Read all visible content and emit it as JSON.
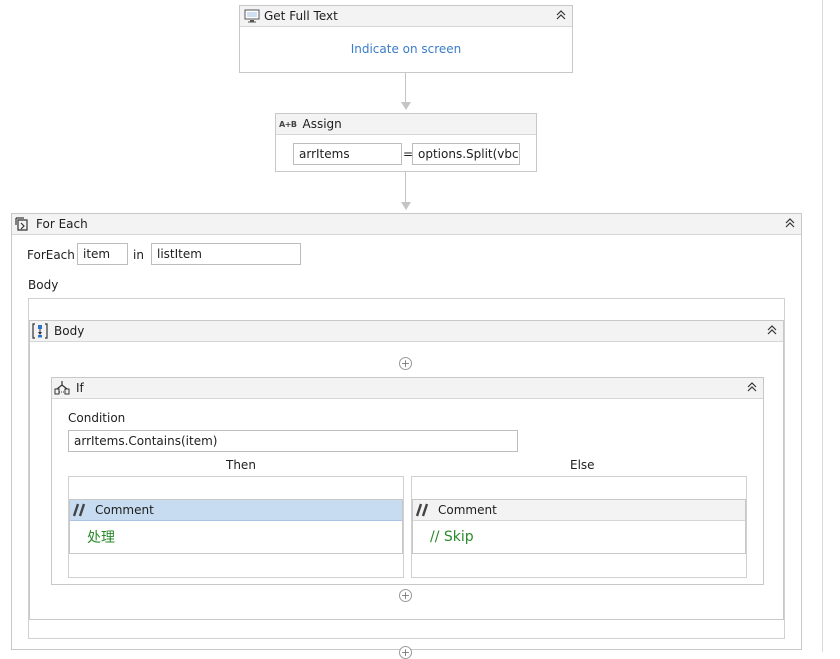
{
  "get_full_text": {
    "title": "Get Full Text",
    "icon": "monitor-icon",
    "indicate_link": "Indicate on screen"
  },
  "assign": {
    "title": "Assign",
    "icon": "assign-ab-icon",
    "icon_text": "A+B",
    "to": "arrItems",
    "equals": "=",
    "value": "options.Split(vbcrlf)"
  },
  "for_each": {
    "title": "For Each",
    "icon": "foreach-icon",
    "foreach_label": "ForEach",
    "item": "item",
    "in_label": "in",
    "collection": "listItem",
    "body_label": "Body"
  },
  "body_sequence": {
    "title": "Body",
    "icon": "sequence-icon"
  },
  "if": {
    "title": "If",
    "icon": "if-icon",
    "condition_label": "Condition",
    "condition": "arrItems.Contains(item)",
    "then_label": "Then",
    "else_label": "Else"
  },
  "then_comment": {
    "title": "Comment",
    "icon": "comment-icon",
    "text": "处理"
  },
  "else_comment": {
    "title": "Comment",
    "icon": "comment-icon",
    "text": "// Skip"
  },
  "colors": {
    "link": "#3b7cc9",
    "selected_header": "#c7dcf1",
    "comment_text": "#2a8a2a"
  }
}
